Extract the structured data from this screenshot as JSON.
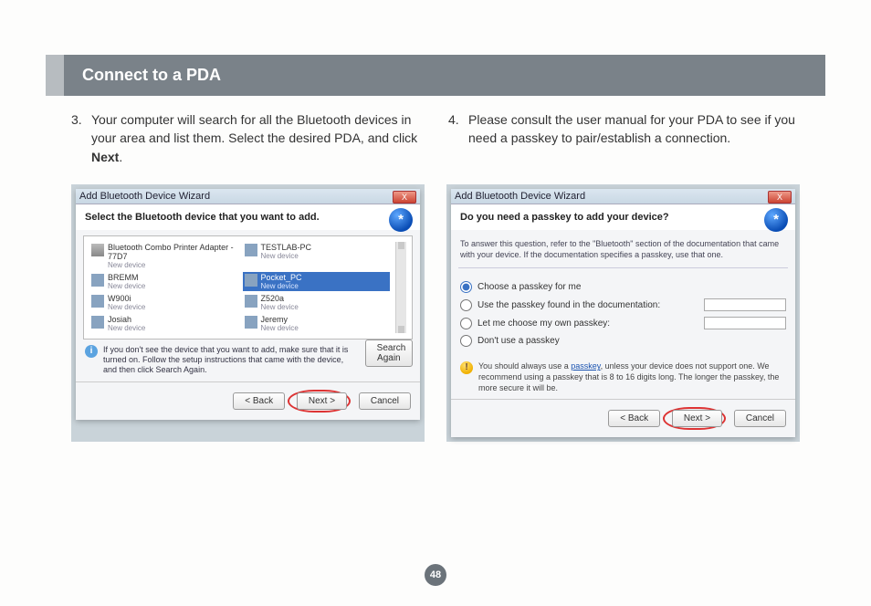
{
  "section_title": "Connect to a PDA",
  "page_number": "48",
  "steps": {
    "left": {
      "num": "3.",
      "text_before_bold": "Your computer will search for all the Bluetooth devices in your area and list them. Select the desired PDA, and click ",
      "bold": "Next",
      "text_after_bold": "."
    },
    "right": {
      "num": "4.",
      "text": "Please consult the user manual for your PDA to see if you need a passkey to pair/establish a connection."
    }
  },
  "dialog_left": {
    "title": "Add Bluetooth Device Wizard",
    "close": "X",
    "heading": "Select the Bluetooth device that you want to add.",
    "bt_glyph": "*",
    "devices": [
      {
        "name": "Bluetooth Combo Printer Adapter - 77D7",
        "sub": "New device",
        "icon": "printer"
      },
      {
        "name": "TESTLAB-PC",
        "sub": "New device",
        "icon": "pc"
      },
      {
        "name": "BREMM",
        "sub": "New device",
        "icon": "pc"
      },
      {
        "name": "Pocket_PC",
        "sub": "New device",
        "icon": "pc",
        "selected": true
      },
      {
        "name": "W900i",
        "sub": "New device",
        "icon": "phone"
      },
      {
        "name": "Z520a",
        "sub": "New device",
        "icon": "phone"
      },
      {
        "name": "Josiah",
        "sub": "New device",
        "icon": "phone"
      },
      {
        "name": "Jeremy",
        "sub": "New device",
        "icon": "phone"
      }
    ],
    "hint": "If you don't see the device that you want to add, make sure that it is turned on. Follow the setup instructions that came with the device, and then click Search Again.",
    "search_again": "Search Again",
    "buttons": {
      "back": "< Back",
      "next": "Next >",
      "cancel": "Cancel"
    }
  },
  "dialog_right": {
    "title": "Add Bluetooth Device Wizard",
    "close": "X",
    "heading": "Do you need a passkey to add your device?",
    "bt_glyph": "*",
    "note": "To answer this question, refer to the \"Bluetooth\" section of the documentation that came with your device. If the documentation specifies a passkey, use that one.",
    "options": [
      {
        "label": "Choose a passkey for me",
        "checked": true,
        "input": false
      },
      {
        "label": "Use the passkey found in the documentation:",
        "checked": false,
        "input": true
      },
      {
        "label": "Let me choose my own passkey:",
        "checked": false,
        "input": true
      },
      {
        "label": "Don't use a passkey",
        "checked": false,
        "input": false
      }
    ],
    "warn_before_link": "You should always use a ",
    "warn_link": "passkey",
    "warn_after_link": ", unless your device does not support one. We recommend using a passkey that is 8 to 16 digits long. The longer the passkey, the more secure it will be.",
    "buttons": {
      "back": "< Back",
      "next": "Next >",
      "cancel": "Cancel"
    }
  }
}
